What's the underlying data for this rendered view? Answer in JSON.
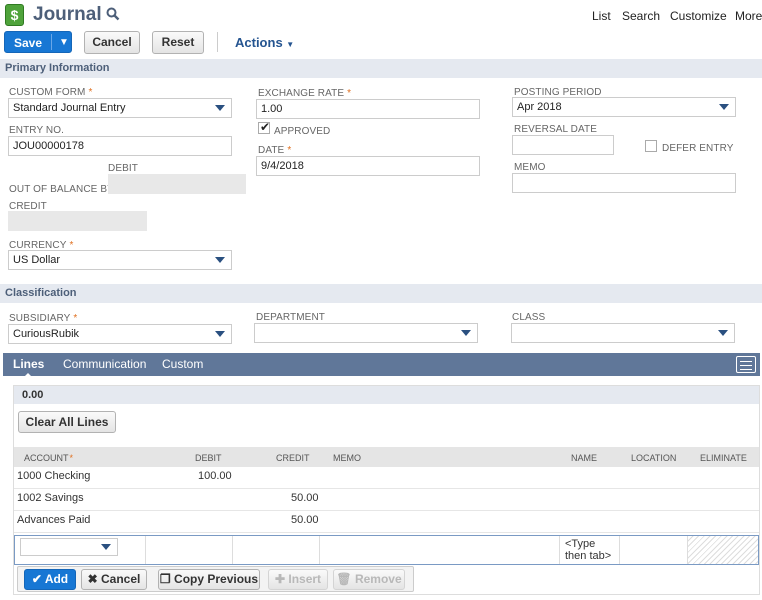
{
  "header": {
    "title": "Journal",
    "nav": [
      "List",
      "Search",
      "Customize",
      "More"
    ]
  },
  "toolbar": {
    "save": "Save",
    "cancel": "Cancel",
    "reset": "Reset",
    "actions": "Actions"
  },
  "primary": {
    "section_title": "Primary Information",
    "custom_form": {
      "label": "CUSTOM FORM",
      "value": "Standard Journal Entry"
    },
    "entry_no": {
      "label": "ENTRY NO.",
      "value": "JOU00000178"
    },
    "debit_label": "DEBIT",
    "out_of_balance_label": "OUT OF BALANCE BY",
    "credit_label": "CREDIT",
    "currency": {
      "label": "CURRENCY",
      "value": "US Dollar"
    },
    "exchange_rate": {
      "label": "EXCHANGE RATE",
      "value": "1.00"
    },
    "approved": {
      "label": "APPROVED",
      "checked": true
    },
    "date": {
      "label": "DATE",
      "value": "9/4/2018"
    },
    "posting_period": {
      "label": "POSTING PERIOD",
      "value": "Apr 2018"
    },
    "reversal_date": {
      "label": "REVERSAL DATE",
      "value": ""
    },
    "defer_entry": {
      "label": "DEFER ENTRY",
      "checked": false
    },
    "memo": {
      "label": "MEMO",
      "value": ""
    }
  },
  "classification": {
    "section_title": "Classification",
    "subsidiary": {
      "label": "SUBSIDIARY",
      "value": "CuriousRubik"
    },
    "department": {
      "label": "DEPARTMENT",
      "value": ""
    },
    "class": {
      "label": "CLASS",
      "value": ""
    }
  },
  "tabs": [
    "Lines",
    "Communication",
    "Custom"
  ],
  "lines": {
    "total": "0.00",
    "clear_all": "Clear All Lines",
    "columns": [
      "ACCOUNT",
      "DEBIT",
      "CREDIT",
      "MEMO",
      "NAME",
      "LOCATION",
      "ELIMINATE"
    ],
    "rows": [
      {
        "account": "1000 Checking",
        "debit": "100.00",
        "credit": ""
      },
      {
        "account": "1002 Savings",
        "debit": "",
        "credit": "50.00"
      },
      {
        "account": "Advances Paid",
        "debit": "",
        "credit": "50.00"
      }
    ],
    "edit_row": {
      "account": "",
      "name_hint": "<Type then tab>"
    },
    "buttons": {
      "add": "Add",
      "cancel": "Cancel",
      "copy_previous": "Copy Previous",
      "insert": "Insert",
      "remove": "Remove"
    }
  },
  "colors": {
    "accent": "#1777d4",
    "section_bg": "#e5e9f0",
    "tab_bar": "#607799",
    "title": "#4d5f79"
  }
}
